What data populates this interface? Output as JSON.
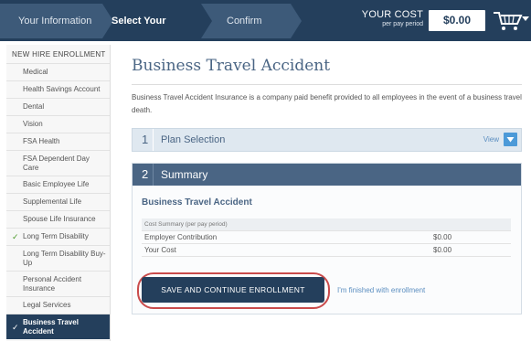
{
  "steps": [
    "Your Information",
    "Select Your Benefits",
    "Confirm"
  ],
  "cost": {
    "label": "YOUR COST",
    "sublabel": "per pay period",
    "value": "$0.00"
  },
  "icons": {
    "cart": "shopping-cart-icon",
    "dropdown": "caret-down-icon",
    "check": "checkmark-icon",
    "chevron": "chevron-down-icon"
  },
  "colors": {
    "navy": "#243f5c",
    "accent": "#4a6584",
    "link": "#5b8ec0",
    "check": "#4c9a2a",
    "highlight": "#c94b4b"
  },
  "sidebar": {
    "header": "NEW HIRE ENROLLMENT",
    "items": [
      {
        "label": "Medical",
        "checked": false,
        "active": false
      },
      {
        "label": "Health Savings Account",
        "checked": false,
        "active": false
      },
      {
        "label": "Dental",
        "checked": false,
        "active": false
      },
      {
        "label": "Vision",
        "checked": false,
        "active": false
      },
      {
        "label": "FSA Health",
        "checked": false,
        "active": false
      },
      {
        "label": "FSA Dependent Day Care",
        "checked": false,
        "active": false
      },
      {
        "label": "Basic Employee Life",
        "checked": false,
        "active": false
      },
      {
        "label": "Supplemental Life",
        "checked": false,
        "active": false
      },
      {
        "label": "Spouse Life Insurance",
        "checked": false,
        "active": false
      },
      {
        "label": "Long Term Disability",
        "checked": true,
        "active": false
      },
      {
        "label": "Long Term Disability Buy-Up",
        "checked": false,
        "active": false
      },
      {
        "label": "Personal Accident Insurance",
        "checked": false,
        "active": false
      },
      {
        "label": "Legal Services",
        "checked": false,
        "active": false
      },
      {
        "label": "Business Travel Accident",
        "checked": true,
        "active": true
      }
    ]
  },
  "main": {
    "title": "Business Travel Accident",
    "description": "Business Travel Accident Insurance is a company paid benefit provided to all employees in the event of a business travel death.",
    "plan_selection": {
      "number": "1",
      "title": "Plan Selection",
      "view_label": "View"
    },
    "summary": {
      "number": "2",
      "title": "Summary",
      "plan_name": "Business Travel Accident",
      "table_header": "Cost Summary (per pay period)",
      "rows": [
        {
          "label": "Employer Contribution",
          "value": "$0.00"
        },
        {
          "label": "Your Cost",
          "value": "$0.00"
        }
      ],
      "save_label": "SAVE AND CONTINUE ENROLLMENT",
      "finished_label": "I'm finished with enrollment"
    }
  }
}
